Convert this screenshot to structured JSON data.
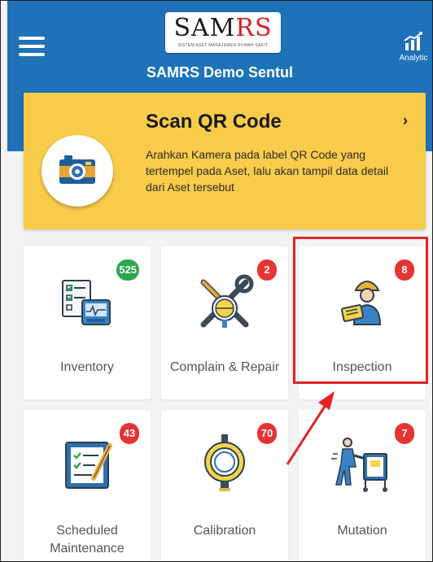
{
  "header": {
    "logo": {
      "part1": "SAM",
      "part2": "RS",
      "tagline": "SISTEM ASET MANAJEMEN RUMAH SAKIT"
    },
    "title": "SAMRS Demo Sentul",
    "analytic_label": "Analytic"
  },
  "scan": {
    "title": "Scan QR Code",
    "chevron": "›",
    "description": "Arahkan Kamera pada label QR Code yang tertempel pada Aset, lalu akan tampil data detail dari Aset tersebut"
  },
  "tiles": [
    {
      "label": "Inventory",
      "badge": "525",
      "badge_color": "#2aa84a",
      "icon": "inventory-checklist-icon"
    },
    {
      "label": "Complain & Repair",
      "badge": "2",
      "badge_color": "#e63333",
      "icon": "repair-tools-icon"
    },
    {
      "label": "Inspection",
      "badge": "8",
      "badge_color": "#e63333",
      "icon": "inspector-icon"
    },
    {
      "label": "Scheduled Maintenance",
      "badge": "43",
      "badge_color": "#e63333",
      "icon": "schedule-checklist-icon"
    },
    {
      "label": "Calibration",
      "badge": "70",
      "badge_color": "#e63333",
      "icon": "calibration-gauge-icon"
    },
    {
      "label": "Mutation",
      "badge": "7",
      "badge_color": "#e63333",
      "icon": "mutation-cart-icon"
    }
  ],
  "annotation": {
    "highlight_color": "#e02424",
    "target": "Inspection"
  }
}
